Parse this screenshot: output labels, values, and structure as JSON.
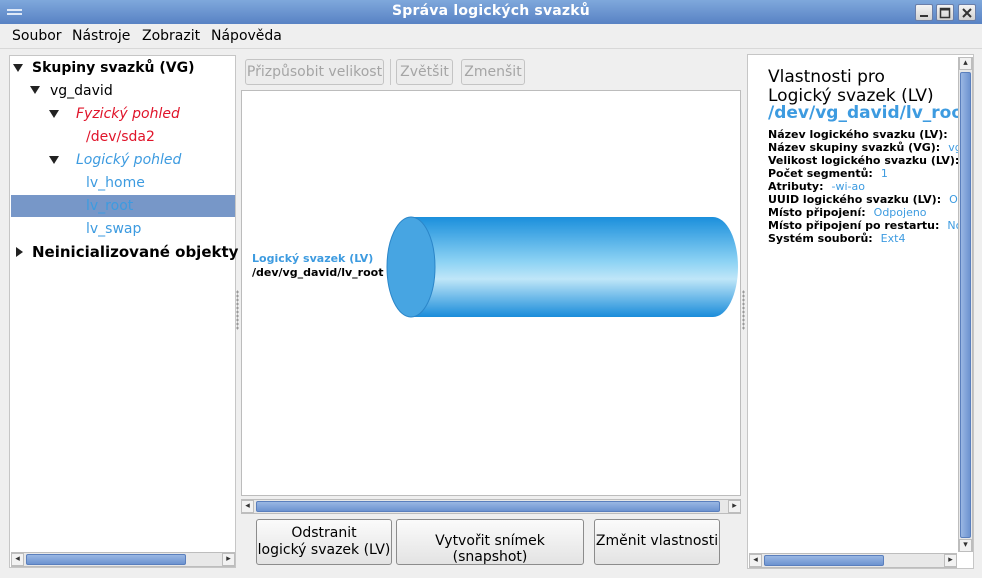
{
  "window": {
    "title": "Správa logických svazků"
  },
  "menu": [
    "Soubor",
    "Nástroje",
    "Zobrazit",
    "Nápověda"
  ],
  "tree": {
    "root_vg": "Skupiny svazků (VG)",
    "vg_name": "vg_david",
    "physical_view": "Fyzický pohled",
    "pv": "/dev/sda2",
    "logical_view": "Logický pohled",
    "lvs": [
      "lv_home",
      "lv_root",
      "lv_swap"
    ],
    "selected_index": 1,
    "uninit": "Neinicializované objekty"
  },
  "toolbar": {
    "resize": "Přizpůsobit velikost",
    "zoom_in": "Zvětšit",
    "zoom_out": "Zmenšit"
  },
  "canvas": {
    "lv_type": "Logický svazek (LV)",
    "lv_path": "/dev/vg_david/lv_root"
  },
  "actions": {
    "remove_line1": "Odstranit",
    "remove_line2": "logický svazek (LV)",
    "snapshot": "Vytvořit snímek (snapshot)",
    "properties": "Změnit vlastnosti"
  },
  "properties": {
    "heading_line1": "Vlastnosti pro",
    "heading_line2": "Logický svazek (LV)",
    "path": "/dev/vg_david/lv_root",
    "rows": [
      {
        "key": "Název logického svazku (LV):",
        "value": ""
      },
      {
        "key": "Název skupiny svazků (VG):",
        "value": "vg"
      },
      {
        "key": "Velikost logického svazku (LV):",
        "value": ""
      },
      {
        "key": "Počet segmentů:",
        "value": "1"
      },
      {
        "key": "Atributy:",
        "value": "-wi-ao"
      },
      {
        "key": "UUID logického svazku (LV):",
        "value": "O"
      },
      {
        "key": "Místo připojení:",
        "value": "Odpojeno"
      },
      {
        "key": "Místo připojení po restartu:",
        "value": "No"
      },
      {
        "key": "Systém souborů:",
        "value": "Ext4"
      }
    ]
  },
  "colors": {
    "accent": "#3d9be0",
    "physical": "#e0142a",
    "selection": "#7797c8"
  }
}
